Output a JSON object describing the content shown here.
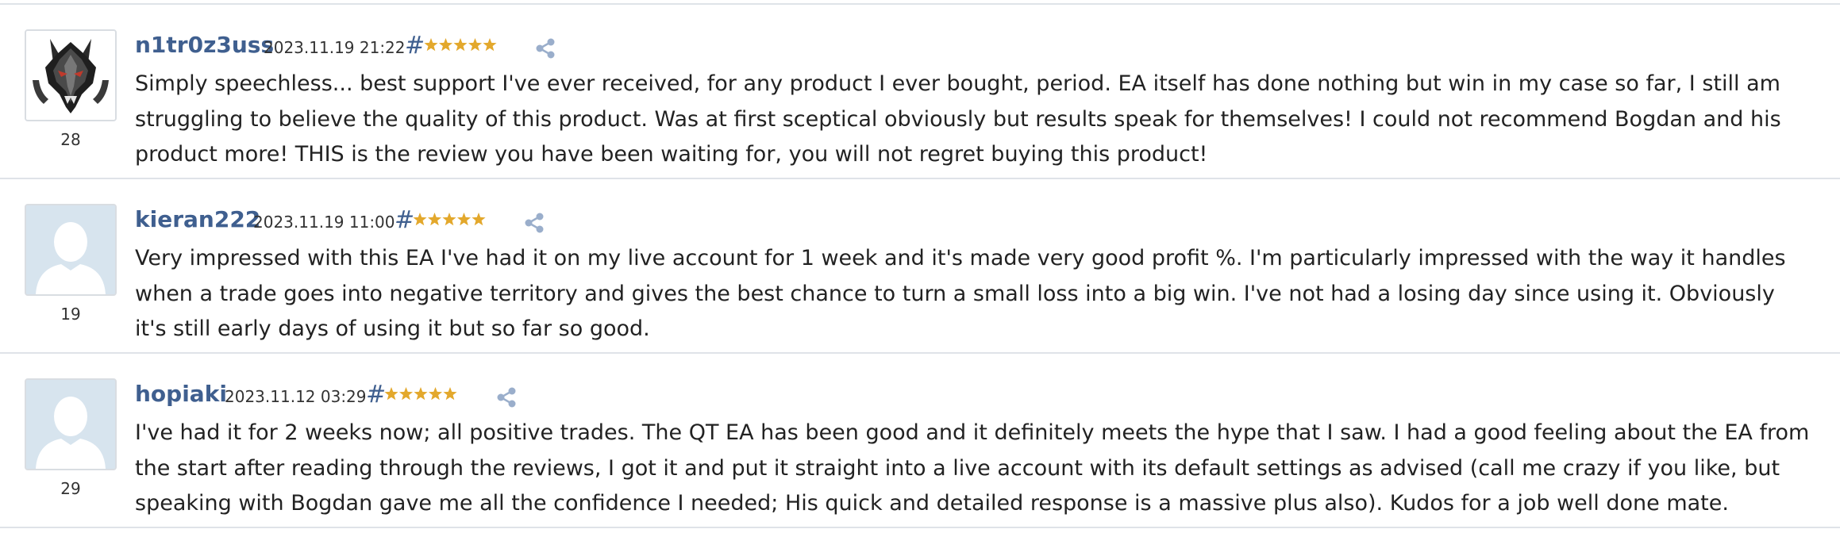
{
  "reviews": [
    {
      "username": "n1tr0z3uss",
      "date": "2023.11.19 21:22",
      "hash": "#",
      "rating": 5,
      "avatar": "witcher-wolf-medallion",
      "rating_count": "28",
      "text": "Simply speechless... best support I've ever received, for any product I ever bought, period. EA itself has done nothing but win in my case so far, I still am struggling to believe the quality of this product. Was at first sceptical obviously but results speak for themselves! I could not recommend Bogdan and his product more! THIS is the review you have been waiting for, you will not regret buying this product!"
    },
    {
      "username": "kieran222",
      "date": "2023.11.19 11:00",
      "hash": "#",
      "rating": 5,
      "avatar": "default-user-silhouette",
      "rating_count": "19",
      "text": "Very impressed with this EA I've had it on my live account for 1 week and it's made very good profit %. I'm particularly impressed with the way it handles when a trade goes into negative territory and gives the best chance to turn a small loss into a big win. I've not had a losing day since using it. Obviously it's still early days of using it but so far so good."
    },
    {
      "username": "hopiaki",
      "date": "2023.11.12 03:29",
      "hash": "#",
      "rating": 5,
      "avatar": "default-user-silhouette",
      "rating_count": "29",
      "text": "I've had it for 2 weeks now; all positive trades. The QT EA has been good and it definitely meets the hype that I saw. I had a good feeling about the EA from the start after reading through the reviews, I got it and put it straight into a live account with its default settings as advised (call me crazy if you like, but speaking with Bogdan gave me all the confidence I needed; His quick and detailed response is a massive plus also). Kudos for a job well done mate."
    }
  ],
  "colors": {
    "username": "#3f5f8f",
    "star": "#e3a82c",
    "divider": "#dfe3e8",
    "share_icon": "#9aaecb",
    "avatar_placeholder": "#d7e4ee"
  },
  "icons": {
    "share": "share-icon",
    "star": "star-icon"
  }
}
